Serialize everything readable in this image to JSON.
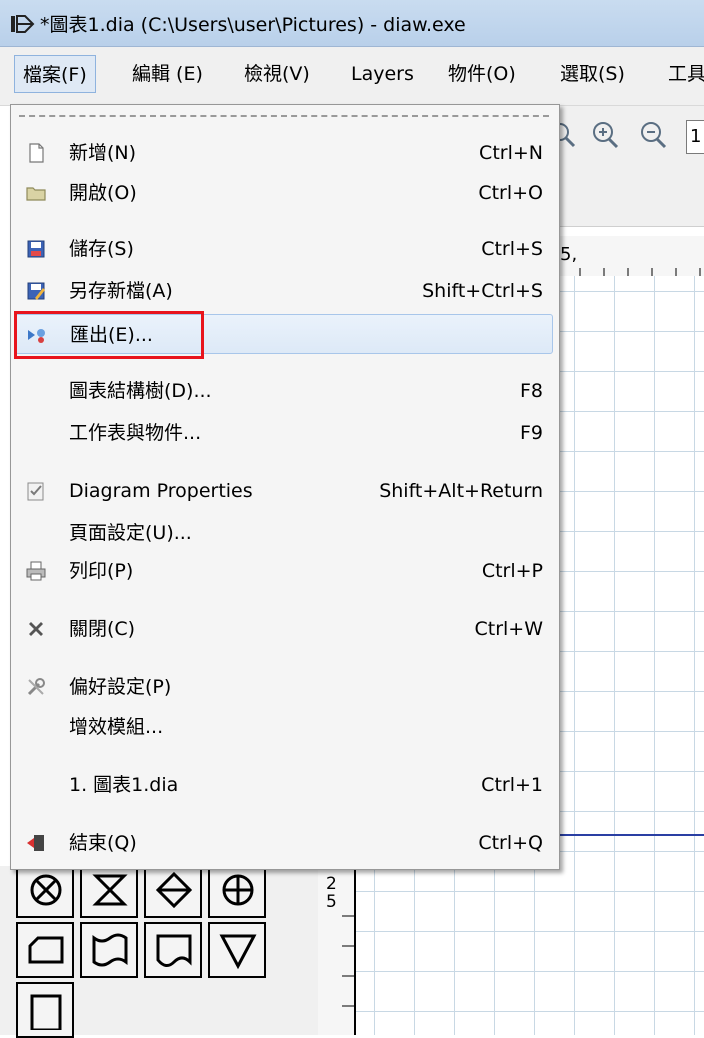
{
  "window": {
    "title": "*圖表1.dia (C:\\Users\\user\\Pictures) - diaw.exe",
    "icon": "dia-app-icon"
  },
  "menubar": {
    "items": [
      "檔案(F)",
      "編輯 (E)",
      "檢視(V)",
      "Layers",
      "物件(O)",
      "選取(S)",
      "工具"
    ]
  },
  "toolbar": {
    "zoom_value": "1"
  },
  "ruler": {
    "top_label": "5,",
    "left_label_1": "2",
    "left_label_2": "5"
  },
  "file_menu": {
    "items": [
      {
        "label": "新增(N)",
        "shortcut": "Ctrl+N",
        "icon": "new-file-icon"
      },
      {
        "label": "開啟(O)",
        "shortcut": "Ctrl+O",
        "icon": "open-folder-icon"
      },
      {
        "label": "儲存(S)",
        "shortcut": "Ctrl+S",
        "icon": "save-icon"
      },
      {
        "label": "另存新檔(A)",
        "shortcut": "Shift+Ctrl+S",
        "icon": "save-as-icon"
      },
      {
        "label": "匯出(E)...",
        "shortcut": "",
        "icon": "export-icon"
      },
      {
        "label": "圖表結構樹(D)...",
        "shortcut": "F8",
        "icon": ""
      },
      {
        "label": "工作表與物件...",
        "shortcut": "F9",
        "icon": ""
      },
      {
        "label": "Diagram Properties",
        "shortcut": "Shift+Alt+Return",
        "icon": "properties-icon"
      },
      {
        "label": "頁面設定(U)...",
        "shortcut": "",
        "icon": ""
      },
      {
        "label": "列印(P)",
        "shortcut": "Ctrl+P",
        "icon": "print-icon"
      },
      {
        "label": "關閉(C)",
        "shortcut": "Ctrl+W",
        "icon": "close-icon"
      },
      {
        "label": "偏好設定(P)",
        "shortcut": "",
        "icon": "preferences-icon"
      },
      {
        "label": "增效模組...",
        "shortcut": "",
        "icon": ""
      },
      {
        "label": "1. 圖表1.dia",
        "shortcut": "Ctrl+1",
        "icon": ""
      },
      {
        "label": "結束(Q)",
        "shortcut": "Ctrl+Q",
        "icon": "quit-icon"
      }
    ],
    "highlighted": "匯出(E)..."
  },
  "colors": {
    "highlight_box": "#e8141c",
    "canvas_grid": "#c8d8e4",
    "line": "#2a3fa3"
  }
}
